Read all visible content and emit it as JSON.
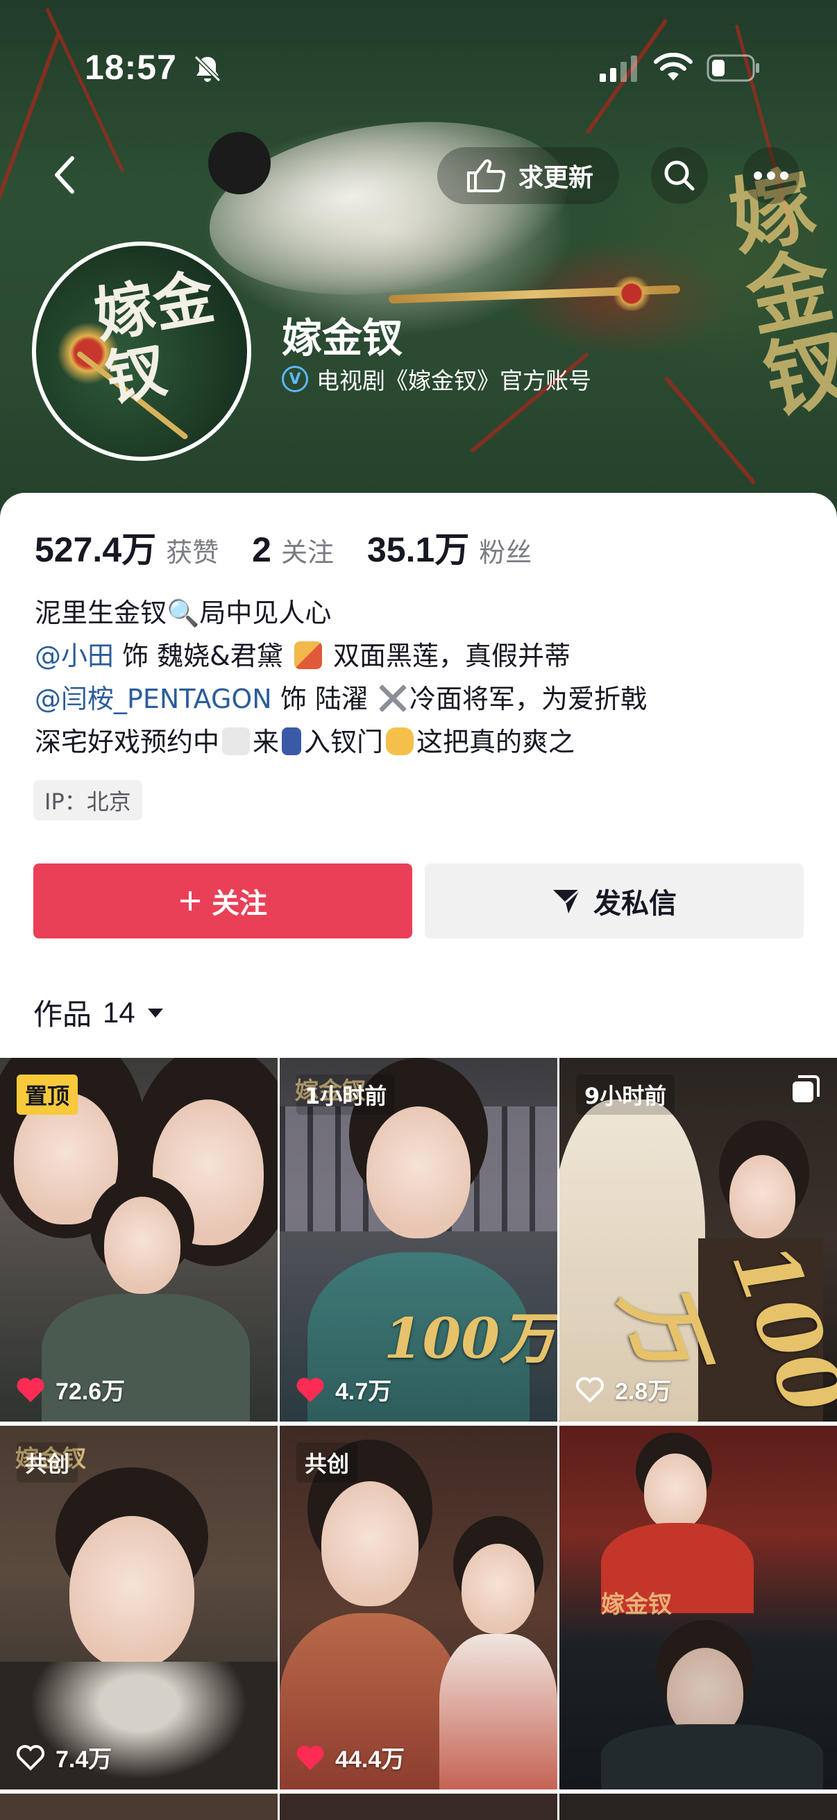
{
  "status_bar": {
    "time": "18:57"
  },
  "header": {
    "update_label": "求更新",
    "account_name": "嫁金钗",
    "verified_text": "电视剧《嫁金钗》官方账号",
    "avatar_text": "嫁金钗",
    "banner_text": "嫁金钗"
  },
  "stats": [
    {
      "value": "527.4万",
      "label": "获赞"
    },
    {
      "value": "2",
      "label": "关注"
    },
    {
      "value": "35.1万",
      "label": "粉丝"
    }
  ],
  "bio": {
    "line1": "泥里生金钗🔍局中见人心",
    "line2_mention": "@小田",
    "line2_text_a": " 饰 魏娆&君黛 ",
    "line2_text_b": " 双面黑莲，真假并蒂",
    "line3_mention": "@闫桉_PENTAGON",
    "line3_text_a": " 饰 陆濯 ",
    "line3_text_b": "冷面将军，为爱折戟",
    "line4_text_a": "深宅好戏预约中",
    "line4_text_b": "来",
    "line4_text_c": "入钗门",
    "line4_text_d": "这把真的爽之"
  },
  "ip_label": "IP：北京",
  "actions": {
    "follow": "关注",
    "message": "发私信"
  },
  "works": {
    "label": "作品",
    "count": "14"
  },
  "videos": [
    {
      "badge": "置顶",
      "likes": "72.6万",
      "liked": true
    },
    {
      "badge": "1小时前",
      "likes": "4.7万",
      "liked": true,
      "overlay": "100万"
    },
    {
      "badge": "9小时前",
      "likes": "2.8万",
      "liked": false,
      "overlay": "100万"
    },
    {
      "badge": "共创",
      "likes": "7.4万",
      "liked": false
    },
    {
      "badge": "共创",
      "likes": "44.4万",
      "liked": true
    },
    {
      "badge": "",
      "likes": "",
      "liked": false
    }
  ],
  "colors": {
    "follow_red": "#ea4057",
    "mention_blue": "#2c5d9a",
    "pin_yellow": "#f8c93b",
    "heart_red": "#fe2c55"
  }
}
